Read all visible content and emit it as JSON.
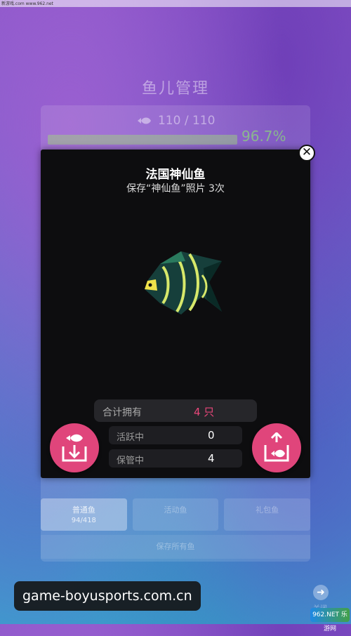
{
  "status_bar": {
    "text": "新游戏.com  www.962.net"
  },
  "background": {
    "title": "鱼儿管理",
    "count": "110 / 110",
    "percent": "96.7%",
    "tabs": [
      {
        "label": "普通鱼",
        "sub": "94/418"
      },
      {
        "label": "活动鱼",
        "sub": ""
      },
      {
        "label": "礼包鱼",
        "sub": ""
      }
    ],
    "save_all": "保存所有鱼",
    "next_label": "关闭"
  },
  "modal": {
    "fish_name": "法国神仙鱼",
    "subtitle": "保存“神仙鱼”照片 3次",
    "total_label": "合计拥有",
    "total_value": "4 只",
    "active_label": "活跃中",
    "active_value": "0",
    "stored_label": "保管中",
    "stored_value": "4",
    "close_icon": "close-icon",
    "store_icon": "fish-store-icon",
    "release_icon": "fish-release-icon"
  },
  "watermark": "game-boyusports.com.cn",
  "brand": "962.NET 乐游网",
  "colors": {
    "accent": "#e0457b",
    "modal_bg": "#0d0d0f",
    "total_value": "#e8477a"
  }
}
